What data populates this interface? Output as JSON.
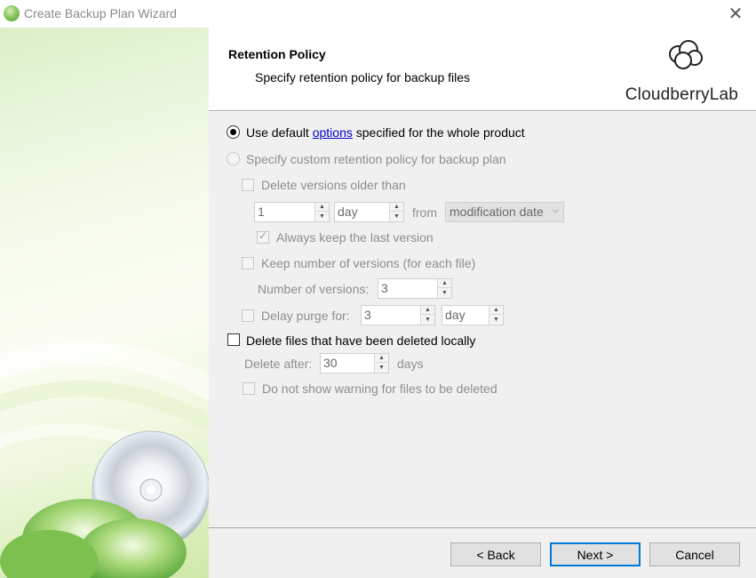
{
  "window": {
    "title": "Create Backup Plan Wizard",
    "close_glyph": "✕"
  },
  "header": {
    "title": "Retention Policy",
    "subtitle": "Specify retention policy for backup files",
    "logo_text": "CloudberryLab"
  },
  "options": {
    "default_radio": {
      "prefix": "Use default ",
      "link": "options",
      "suffix": " specified for the whole product",
      "checked": true
    },
    "custom_radio": {
      "label": "Specify custom retention policy for backup plan",
      "checked": false,
      "enabled": false
    },
    "delete_older": {
      "label": "Delete versions older than",
      "checked": false,
      "amount": "1",
      "unit": "day",
      "from_label": "from",
      "date_type": "modification date"
    },
    "keep_last": {
      "label": "Always keep the last version",
      "checked": true
    },
    "keep_number": {
      "label": "Keep number of versions (for each file)",
      "checked": false
    },
    "number_of_versions": {
      "label": "Number of versions:",
      "value": "3"
    },
    "delay_purge": {
      "label": "Delay purge for:",
      "checked": false,
      "amount": "3",
      "unit": "day"
    },
    "delete_local": {
      "label": "Delete files that have been deleted locally",
      "checked": false
    },
    "delete_after": {
      "label": "Delete after:",
      "value": "30",
      "unit": "days"
    },
    "no_warning": {
      "label": "Do not show warning for files to be deleted",
      "checked": false
    }
  },
  "footer": {
    "back": "< Back",
    "next": "Next >",
    "cancel": "Cancel"
  },
  "colors": {
    "accent": "#0078d7",
    "link": "#0000cc",
    "disabled_text": "#8e8e8e"
  }
}
